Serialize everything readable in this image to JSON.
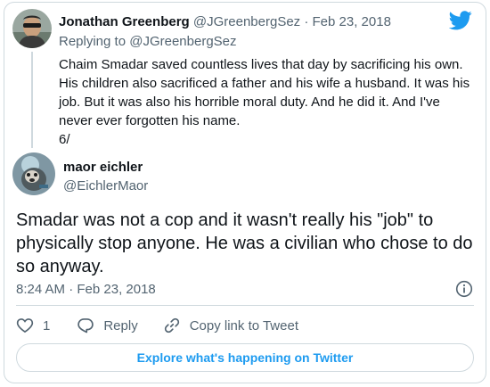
{
  "parent_tweet": {
    "display_name": "Jonathan Greenberg",
    "handle": "@JGreenbergSez",
    "separator": "·",
    "date": "Feb 23, 2018",
    "replying_prefix": "Replying to",
    "replying_handle": "@JGreenbergSez",
    "text_lines": [
      "Chaim Smadar saved countless lives that day by sacrificing his own.",
      "His children also sacrificed a father and his wife a husband. It was his",
      "job. But it was also his horrible moral duty. And he did it. And I've",
      "never ever forgotten his name.",
      "6/"
    ]
  },
  "main_tweet": {
    "display_name": "maor eichler",
    "handle": "@EichlerMaor",
    "text_lines": [
      "Smadar was not a cop and it wasn't really his \"job\" to",
      "physically stop anyone. He was a civilian who chose to do",
      "so anyway."
    ],
    "timestamp": "8:24 AM · Feb 23, 2018"
  },
  "actions": {
    "like_count": "1",
    "reply_label": "Reply",
    "copy_link_label": "Copy link to Tweet"
  },
  "explore_label": "Explore what's happening on Twitter",
  "colors": {
    "brand": "#1d9bf0",
    "text": "#0f1419",
    "muted": "#536471",
    "border": "#cfd9de"
  },
  "icons": [
    "twitter-bird-icon",
    "info-icon",
    "heart-icon",
    "reply-icon",
    "link-icon"
  ]
}
